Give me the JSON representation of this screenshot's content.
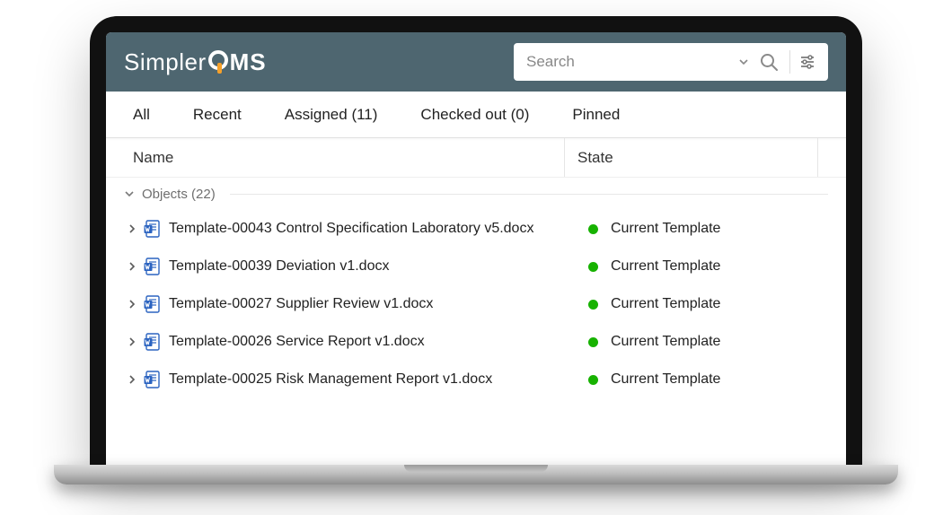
{
  "brand": {
    "part1": "Simpler",
    "part2": "MS"
  },
  "search": {
    "placeholder": "Search"
  },
  "tabs": [
    {
      "label": "All"
    },
    {
      "label": "Recent"
    },
    {
      "label": "Assigned (11)"
    },
    {
      "label": "Checked out (0)"
    },
    {
      "label": "Pinned"
    }
  ],
  "columns": {
    "name": "Name",
    "state": "State"
  },
  "group": {
    "label": "Objects (22)"
  },
  "state_label": "Current Template",
  "rows": [
    {
      "name": "Template-00043 Control Specification Laboratory v5.docx"
    },
    {
      "name": "Template-00039 Deviation v1.docx"
    },
    {
      "name": "Template-00027 Supplier Review v1.docx"
    },
    {
      "name": "Template-00026 Service Report v1.docx"
    },
    {
      "name": "Template-00025 Risk Management Report v1.docx"
    }
  ]
}
